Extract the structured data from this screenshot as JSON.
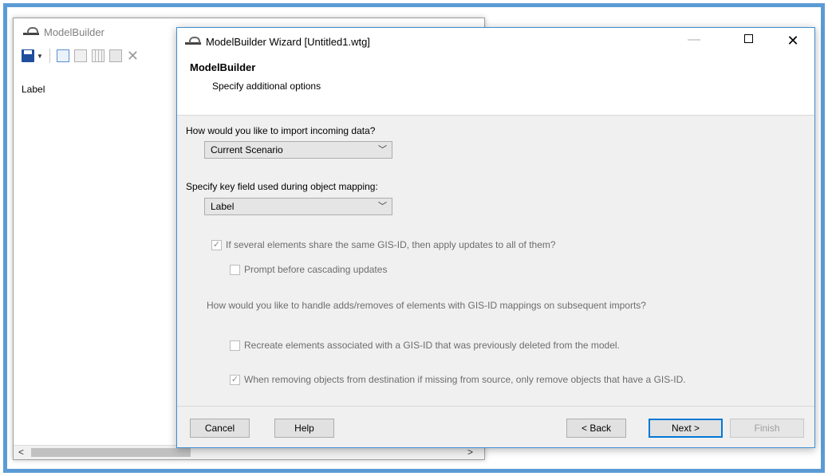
{
  "background_window": {
    "title": "ModelBuilder",
    "list_item": "Label",
    "scroll_left": "<",
    "scroll_right": ">"
  },
  "dialog": {
    "title": "ModelBuilder Wizard [Untitled1.wtg]",
    "minimize": "—",
    "close": "✕",
    "heading": "ModelBuilder",
    "subheading": "Specify additional options",
    "import_question": "How would you like to import incoming data?",
    "import_value": "Current Scenario",
    "key_field_question": "Specify key field used during object mapping:",
    "key_field_value": "Label",
    "share_gis_id_label": "If several elements share the same GIS-ID, then apply updates to all of them?",
    "share_gis_id_checked": true,
    "prompt_cascade_label": "Prompt before cascading updates",
    "prompt_cascade_checked": false,
    "adds_removes_question": "How would you like to handle adds/removes of elements with GIS-ID mappings on subsequent imports?",
    "recreate_label": "Recreate elements associated with a GIS-ID that was previously deleted from the model.",
    "recreate_checked": false,
    "remove_label": "When removing objects from destination if missing from source, only remove objects that have a GIS-ID.",
    "remove_checked": true
  },
  "buttons": {
    "cancel": "Cancel",
    "help": "Help",
    "back": "< Back",
    "next": "Next >",
    "finish": "Finish"
  },
  "glyphs": {
    "check": "✓",
    "chevron": "﹀",
    "scroll_left": "<",
    "scroll_right": ">"
  },
  "colors": {
    "frame_border": "#5b9bd5",
    "dialog_border": "#3d8fd1",
    "primary_button_border": "#0078d7"
  }
}
